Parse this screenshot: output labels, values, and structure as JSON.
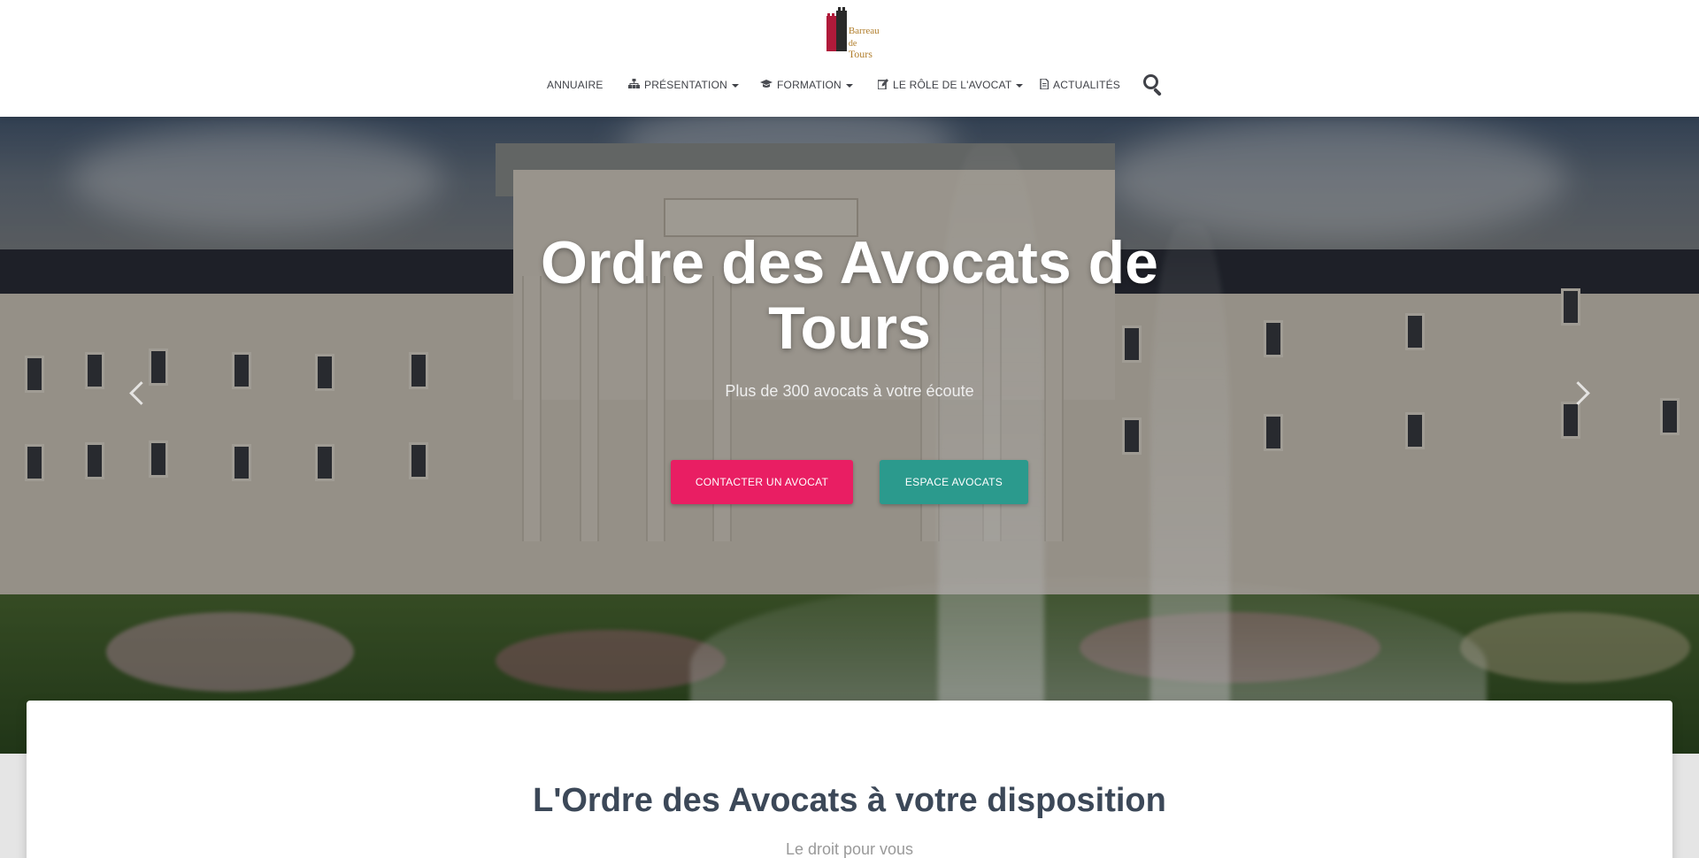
{
  "logo": {
    "line1": "Barreau",
    "line2_prefix": "de",
    "line2_name": "Tours"
  },
  "nav": {
    "items": [
      {
        "label": "ANNUAIRE",
        "icon": "",
        "dropdown": false
      },
      {
        "label": "PRÉSENTATION",
        "icon": "sitemap-icon",
        "dropdown": true
      },
      {
        "label": "FORMATION",
        "icon": "graduation-cap-icon",
        "dropdown": true
      },
      {
        "label": "LE RÔLE DE L'AVOCAT",
        "icon": "edit-icon",
        "dropdown": true
      },
      {
        "label": "ACTUALITÉS",
        "icon": "file-text-icon",
        "dropdown": false
      }
    ],
    "search_icon": "search-icon"
  },
  "hero": {
    "title": "Ordre des Avocats de Tours",
    "subtitle": "Plus de 300 avocats à votre écoute",
    "primary_button": "CONTACTER UN AVOCAT",
    "secondary_button": "ESPACE AVOCATS",
    "prev_icon": "chevron-left-icon",
    "next_icon": "chevron-right-icon"
  },
  "section": {
    "title": "L'Ordre des Avocats à votre disposition",
    "subtitle": "Le droit pour vous"
  },
  "colors": {
    "primary_button": "#e91e63",
    "secondary_button": "#2b9a8d",
    "heading": "#3c4858",
    "logo_red": "#b01a3a",
    "logo_gold": "#b07d2a"
  }
}
